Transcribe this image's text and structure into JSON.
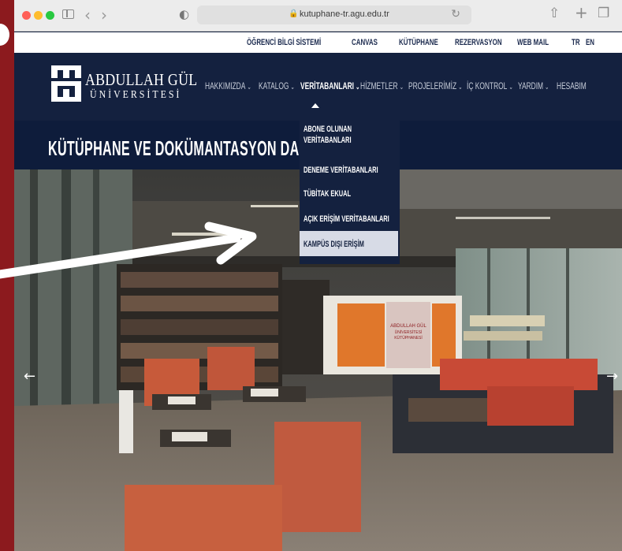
{
  "browser": {
    "url": "kutuphane-tr.agu.edu.tr"
  },
  "utility_bar": {
    "links": [
      "ÖĞRENCİ BİLGİ SİSTEMİ",
      "CANVAS",
      "KÜTÜPHANE",
      "REZERVASYON",
      "WEB MAIL",
      "TR",
      "EN"
    ]
  },
  "logo": {
    "name": "ABDULLAH GÜL",
    "sub": "ÜNİVERSİTESİ"
  },
  "nav": {
    "items": [
      {
        "label": "HAKKIMIZDA"
      },
      {
        "label": "KATALOG"
      },
      {
        "label": "VERİTABANLARI"
      },
      {
        "label": "HİZMETLER"
      },
      {
        "label": "PROJELERİMİZ"
      },
      {
        "label": "İÇ KONTROL"
      },
      {
        "label": "YARDIM"
      },
      {
        "label": "HESABIM"
      }
    ],
    "active_index": 2
  },
  "page": {
    "title": "KÜTÜPHANE VE DOKÜMANTASYON DAİRE BAŞ"
  },
  "dropdown": {
    "items": [
      {
        "line1": "ABONE OLUNAN",
        "line2": "VERİTABANLARI"
      },
      {
        "line1": "DENEME VERİTABANLARI"
      },
      {
        "line1": "TÜBİTAK EKUAL"
      },
      {
        "line1": "AÇIK ERİŞİM VERİTABANLARI"
      },
      {
        "line1": "KAMPÜS DIŞI ERİŞİM"
      }
    ],
    "highlighted_index": 4
  },
  "hero": {
    "sign_line1": "ABDULLAH GÜL",
    "sign_line2": "ÜNİVERSİTESİ",
    "sign_line3": "KÜTÜPHANESİ"
  },
  "icons": {
    "back": "chevron-left-icon",
    "forward": "chevron-right-icon",
    "share": "share-icon",
    "new_tab": "plus-icon",
    "tabs": "tabs-icon",
    "carousel_prev": "arrow-left-icon",
    "carousel_next": "arrow-right-icon"
  },
  "colors": {
    "frame": "#8c1a1e",
    "nav_bg": "#14213f",
    "highlight": "#d7dbe6",
    "accent_orange": "#e0772b",
    "annotation_arrow": "#ffffff"
  }
}
